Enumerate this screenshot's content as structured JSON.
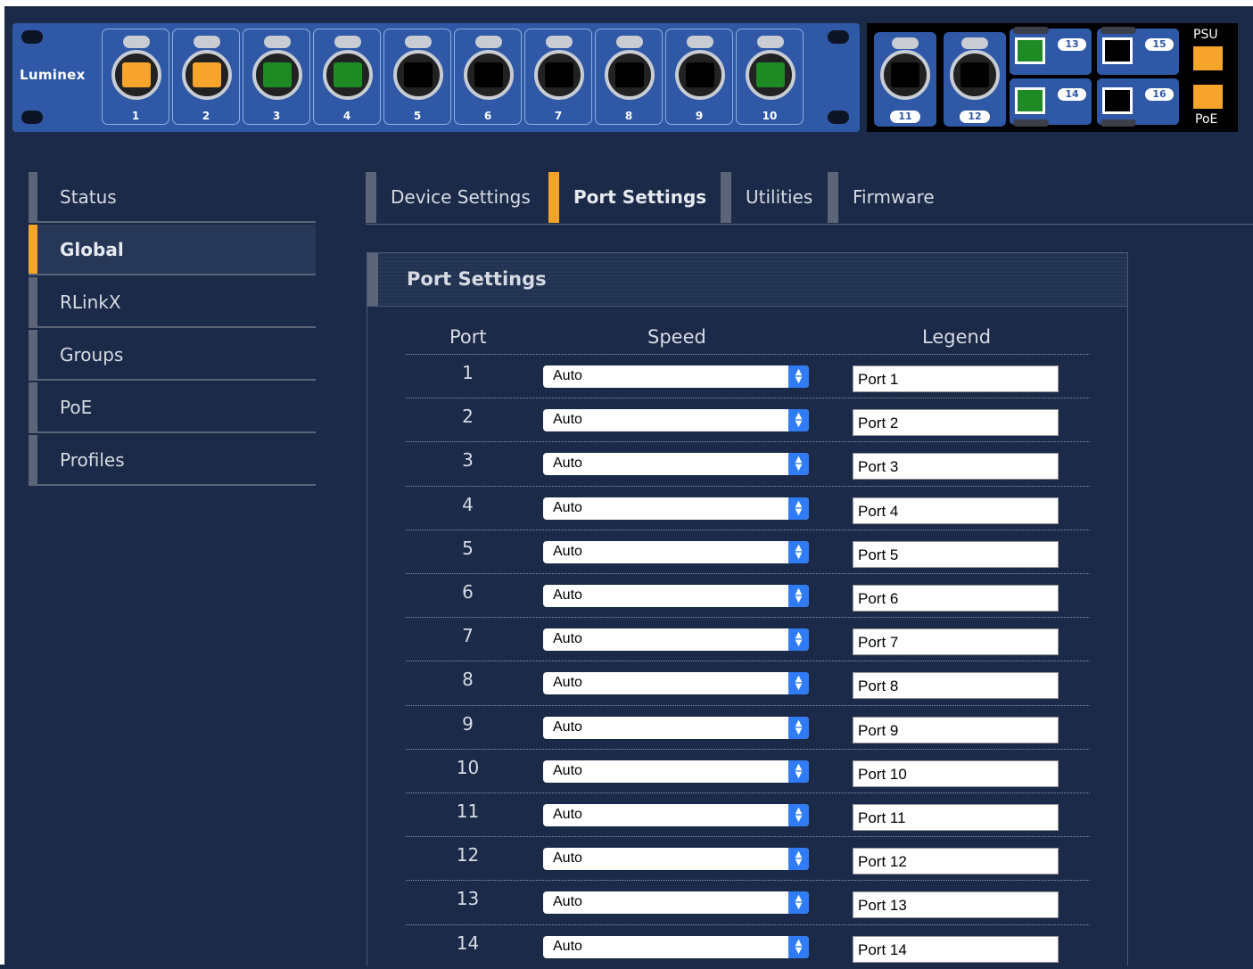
{
  "device": {
    "brand": "Luminex",
    "ports": [
      {
        "num": "1",
        "color": "#f7a42d"
      },
      {
        "num": "2",
        "color": "#f7a42d"
      },
      {
        "num": "3",
        "color": "#1d8a24"
      },
      {
        "num": "4",
        "color": "#1d8a24"
      },
      {
        "num": "5",
        "color": "#000000"
      },
      {
        "num": "6",
        "color": "#000000"
      },
      {
        "num": "7",
        "color": "#000000"
      },
      {
        "num": "8",
        "color": "#000000"
      },
      {
        "num": "9",
        "color": "#000000"
      },
      {
        "num": "10",
        "color": "#1d8a24"
      }
    ],
    "uplink_ports": [
      "11",
      "12"
    ],
    "sfp_ports": [
      {
        "num": "13",
        "color": "#1d8a24"
      },
      {
        "num": "14",
        "color": "#1d8a24"
      },
      {
        "num": "15",
        "color": "#000000"
      },
      {
        "num": "16",
        "color": "#000000"
      }
    ],
    "psu_label": "PSU",
    "poe_label": "PoE",
    "indicator_color": "#f7a42d"
  },
  "nav": {
    "items": [
      {
        "label": "Status"
      },
      {
        "label": "Global"
      },
      {
        "label": "RLinkX"
      },
      {
        "label": "Groups"
      },
      {
        "label": "PoE"
      },
      {
        "label": "Profiles"
      }
    ],
    "active": "Global"
  },
  "tabs": {
    "items": [
      {
        "label": "Device Settings"
      },
      {
        "label": "Port Settings"
      },
      {
        "label": "Utilities"
      },
      {
        "label": "Firmware"
      }
    ],
    "active": "Port Settings"
  },
  "port_settings": {
    "title": "Port Settings",
    "headers": {
      "port": "Port",
      "speed": "Speed",
      "legend": "Legend"
    },
    "rows": [
      {
        "port": "1",
        "speed": "Auto",
        "legend": "Port 1"
      },
      {
        "port": "2",
        "speed": "Auto",
        "legend": "Port 2"
      },
      {
        "port": "3",
        "speed": "Auto",
        "legend": "Port 3"
      },
      {
        "port": "4",
        "speed": "Auto",
        "legend": "Port 4"
      },
      {
        "port": "5",
        "speed": "Auto",
        "legend": "Port 5"
      },
      {
        "port": "6",
        "speed": "Auto",
        "legend": "Port 6"
      },
      {
        "port": "7",
        "speed": "Auto",
        "legend": "Port 7"
      },
      {
        "port": "8",
        "speed": "Auto",
        "legend": "Port 8"
      },
      {
        "port": "9",
        "speed": "Auto",
        "legend": "Port 9"
      },
      {
        "port": "10",
        "speed": "Auto",
        "legend": "Port 10"
      },
      {
        "port": "11",
        "speed": "Auto",
        "legend": "Port 11"
      },
      {
        "port": "12",
        "speed": "Auto",
        "legend": "Port 12"
      },
      {
        "port": "13",
        "speed": "Auto",
        "legend": "Port 13"
      },
      {
        "port": "14",
        "speed": "Auto",
        "legend": "Port 14"
      }
    ]
  }
}
